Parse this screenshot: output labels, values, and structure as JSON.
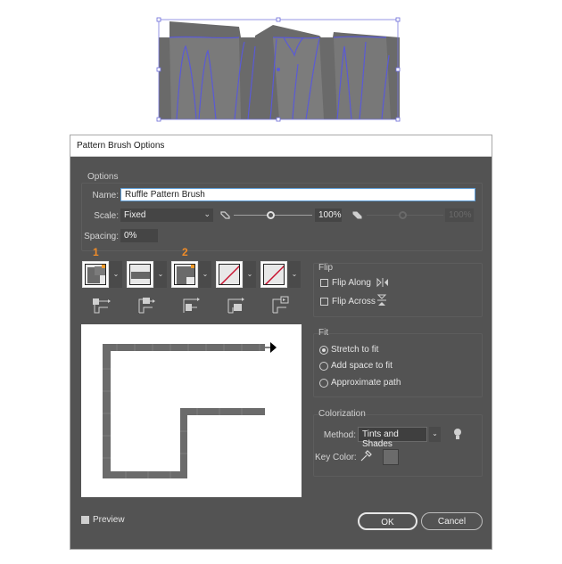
{
  "dialog": {
    "title": "Pattern Brush Options",
    "options_group_label": "Options",
    "name_label": "Name:",
    "name_value": "Ruffle Pattern Brush",
    "scale_label": "Scale:",
    "scale_selected": "Fixed",
    "scale_min_value": "100%",
    "scale_max_value": "100%",
    "spacing_label": "Spacing:",
    "spacing_value": "0%",
    "tiles": [
      {
        "name": "side-tile",
        "callout": "1",
        "state": "pattern",
        "has_corner_marker": true
      },
      {
        "name": "outer-corner-tile",
        "callout": "",
        "state": "pattern",
        "has_corner_marker": false
      },
      {
        "name": "inner-corner-tile",
        "callout": "2",
        "state": "pattern",
        "has_corner_marker": true
      },
      {
        "name": "start-tile",
        "callout": "",
        "state": "none",
        "has_corner_marker": false
      },
      {
        "name": "end-tile",
        "callout": "",
        "state": "none",
        "has_corner_marker": false
      }
    ],
    "flip": {
      "label": "Flip",
      "flip_along": {
        "label": "Flip Along",
        "checked": false
      },
      "flip_across": {
        "label": "Flip Across",
        "checked": false
      }
    },
    "fit": {
      "label": "Fit",
      "options": [
        {
          "label": "Stretch to fit",
          "selected": true
        },
        {
          "label": "Add space to fit",
          "selected": false
        },
        {
          "label": "Approximate path",
          "selected": false
        }
      ]
    },
    "colorization": {
      "label": "Colorization",
      "method_label": "Method:",
      "method_value": "Tints and Shades",
      "key_color_label": "Key Color:",
      "key_color": "#6b6b6b"
    },
    "preview": {
      "label": "Preview",
      "checked": true
    },
    "ok_label": "OK",
    "cancel_label": "Cancel"
  },
  "colors": {
    "dialog_bg": "#535353",
    "selection_blue": "#5a5ad6",
    "callout_orange": "#f08c28",
    "pattern_gray": "#6b6b6b"
  }
}
